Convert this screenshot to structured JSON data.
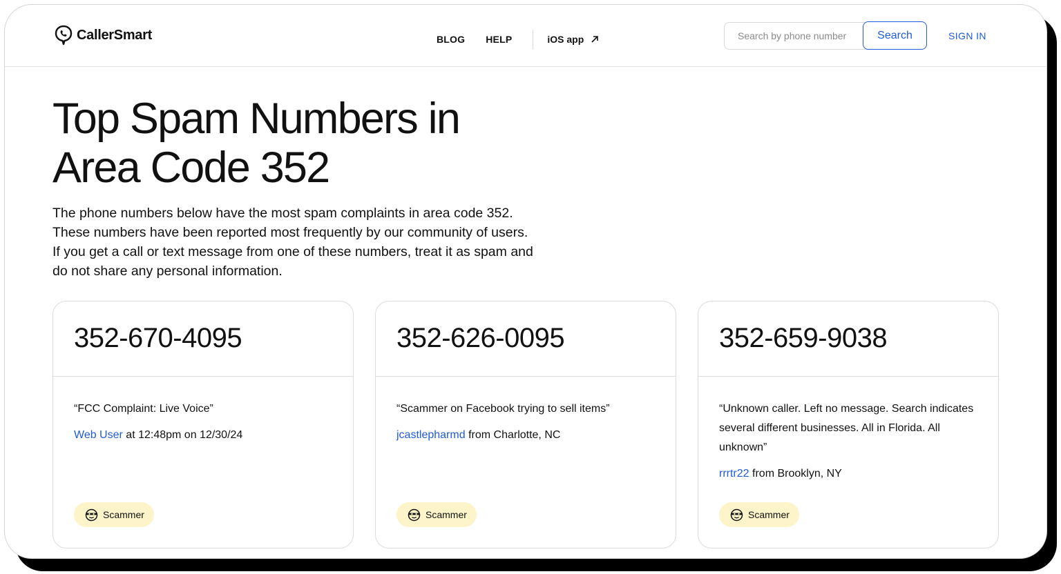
{
  "header": {
    "brand": "CallerSmart",
    "nav": [
      "BLOG",
      "HELP"
    ],
    "ios_app": "iOS app",
    "search_placeholder": "Search by phone number",
    "search_button": "Search",
    "sign_in": "SIGN IN"
  },
  "page": {
    "title": "Top Spam Numbers in Area Code 352",
    "intro": "The phone numbers below have the most spam complaints in area code 352. These numbers have been reported most frequently by our community of users. If you get a call or text message from one of these numbers, treat it as spam and do not share any personal information."
  },
  "cards": [
    {
      "phone": "352-670-4095",
      "quote": "“FCC Complaint: Live Voice”",
      "user": "Web User",
      "detail": "at 12:48pm on 12/30/24",
      "badge": "Scammer"
    },
    {
      "phone": "352-626-0095",
      "quote": "“Scammer on Facebook trying to sell items”",
      "user": "jcastlepharmd",
      "detail": "from Charlotte, NC",
      "badge": "Scammer"
    },
    {
      "phone": "352-659-9038",
      "quote": "“Unknown caller. Left no message. Search indicates several different businesses. All in Florida. All unknown”",
      "user": "rrrtr22",
      "detail": "from Brooklyn, NY",
      "badge": "Scammer"
    }
  ],
  "colors": {
    "accent": "#1f5bd8",
    "badge_bg": "#fdf5c9",
    "border": "#dcdcdc"
  },
  "icons": {
    "logo": "phone-bubble-icon",
    "external": "arrow-up-right-icon",
    "badge": "masked-face-icon"
  }
}
